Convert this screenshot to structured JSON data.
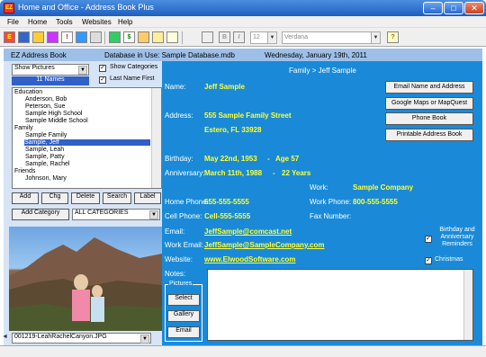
{
  "window": {
    "title": "Home and Office - Address Book Plus",
    "icon_text": "EZ"
  },
  "menu": [
    "File",
    "Home",
    "Tools",
    "Websites",
    "Help"
  ],
  "toolbar": {
    "font_size": "12",
    "font_name": "Verdana",
    "bold": "B",
    "italic": "I"
  },
  "header": {
    "app_name": "EZ Address Book",
    "database": "Database in Use: Sample Database.mdb",
    "date": "Wednesday, January 19th, 2011"
  },
  "left": {
    "filter": "Show Pictures",
    "names_count": "11 Names",
    "show_categories": "Show Categories",
    "last_name_first": "Last Name First",
    "list": [
      {
        "text": "Education",
        "type": "group"
      },
      {
        "text": "Anderson, Bob",
        "type": "item"
      },
      {
        "text": "Peterson, Sue",
        "type": "item"
      },
      {
        "text": "Sample High School",
        "type": "item"
      },
      {
        "text": "Sample Middle School",
        "type": "item"
      },
      {
        "text": "Family",
        "type": "group"
      },
      {
        "text": "Sample Family",
        "type": "item"
      },
      {
        "text": "Sample, Jeff",
        "type": "selected"
      },
      {
        "text": "Sample, Leah",
        "type": "item"
      },
      {
        "text": "Sample, Patty",
        "type": "item"
      },
      {
        "text": "Sample, Rachel",
        "type": "item"
      },
      {
        "text": "Friends",
        "type": "group"
      },
      {
        "text": "Johnson, Mary",
        "type": "item"
      }
    ],
    "buttons": {
      "add": "Add",
      "chg": "Chg",
      "delete": "Delete",
      "search": "Search",
      "label": "Label"
    },
    "add_category": "Add Category",
    "category_select": "ALL CATEGORIES",
    "picture_file": "001219-LeahRachelCanyon.JPG"
  },
  "contact": {
    "breadcrumb": "Family > Jeff Sample",
    "name_label": "Name:",
    "name": "Jeff Sample",
    "address_label": "Address:",
    "address1": "555 Sample Family Street",
    "address2": "Estero, FL  33928",
    "birthday_label": "Birthday:",
    "birthday": "May 22nd, 1953",
    "age": "Age 57",
    "anniversary_label": "Anniversary:",
    "anniversary": "March 11th, 1988",
    "years": "22 Years",
    "dash": "-",
    "work_label": "Work:",
    "work": "Sample Company",
    "home_phone_label": "Home Phone:",
    "home_phone": "555-555-5555",
    "work_phone_label": "Work Phone:",
    "work_phone": "800-555-5555",
    "cell_phone_label": "Cell Phone:",
    "cell_phone": "Cell-555-5555",
    "fax_label": "Fax Number:",
    "email_label": "Email:",
    "email": "JeffSample@comcast.net",
    "work_email_label": "Work Email:",
    "work_email": "JeffSample@SampleCompany.com",
    "website_label": "Website:",
    "website": "www.ElwoodSoftware.com",
    "notes_label": "Notes:",
    "reminders": "Birthday and Anniversary Reminders",
    "christmas": "Christmas"
  },
  "actions": {
    "email_name": "Email Name and Address",
    "maps": "Google Maps or MapQuest",
    "phone_book": "Phone Book",
    "printable": "Printable Address Book"
  },
  "pictures": {
    "legend": "Pictures",
    "select": "Select",
    "gallery": "Gallery",
    "email": "Email"
  }
}
